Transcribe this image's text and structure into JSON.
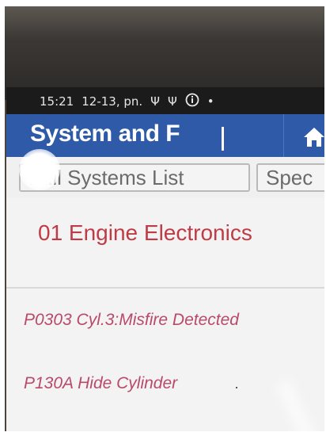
{
  "status_bar": {
    "time": "15:21",
    "date": "12-13, pn.",
    "icons": [
      "usb-icon",
      "usb-debug-icon",
      "info-icon",
      "dot-icon"
    ]
  },
  "app_bar": {
    "title": "System and F",
    "home_icon": "home-icon",
    "color": "#2f5aa8"
  },
  "tabs": {
    "full_systems": "Full Systems List",
    "special": "Spec"
  },
  "content": {
    "section_title": "01 Engine Electronics",
    "dtcs": [
      "P0303 Cyl.3:Misfire Detected",
      "P130A Hide Cylinder"
    ]
  },
  "colors": {
    "accent": "#2f5aa8",
    "section_title": "#bf3c46",
    "dtc_text": "#b84a6a"
  }
}
